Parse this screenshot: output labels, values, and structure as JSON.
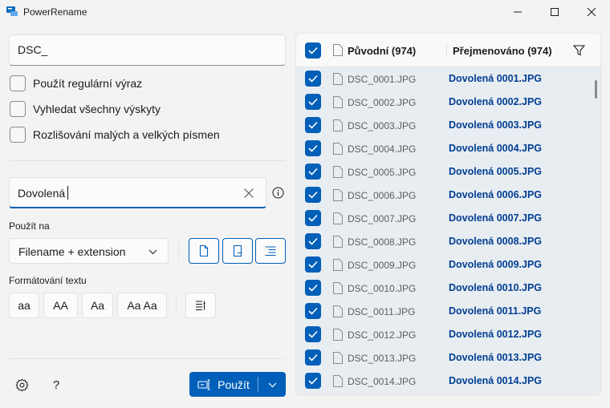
{
  "window": {
    "title": "PowerRename",
    "accent": "#005fb8"
  },
  "search": {
    "value": "DSC_",
    "options": [
      {
        "label": "Použít regulární výraz",
        "checked": false
      },
      {
        "label": "Vyhledat všechny výskyty",
        "checked": false
      },
      {
        "label": "Rozlišování malých a velkých písmen",
        "checked": false
      }
    ]
  },
  "replace": {
    "value": "Dovolená"
  },
  "apply_to": {
    "label": "Použít na",
    "selected": "Filename + extension"
  },
  "text_formatting": {
    "label": "Formátování textu",
    "buttons": [
      "aa",
      "AA",
      "Aa",
      "Aa Aa"
    ]
  },
  "footer": {
    "apply_label": "Použít",
    "help_label": "?"
  },
  "list": {
    "header_original": "Původní (974)",
    "header_renamed": "Přejmenováno (974)",
    "rows": [
      {
        "original": "DSC_0001.JPG",
        "renamed": "Dovolená 0001.JPG"
      },
      {
        "original": "DSC_0002.JPG",
        "renamed": "Dovolená 0002.JPG"
      },
      {
        "original": "DSC_0003.JPG",
        "renamed": "Dovolená 0003.JPG"
      },
      {
        "original": "DSC_0004.JPG",
        "renamed": "Dovolená 0004.JPG"
      },
      {
        "original": "DSC_0005.JPG",
        "renamed": "Dovolená 0005.JPG"
      },
      {
        "original": "DSC_0006.JPG",
        "renamed": "Dovolená 0006.JPG"
      },
      {
        "original": "DSC_0007.JPG",
        "renamed": "Dovolená 0007.JPG"
      },
      {
        "original": "DSC_0008.JPG",
        "renamed": "Dovolená 0008.JPG"
      },
      {
        "original": "DSC_0009.JPG",
        "renamed": "Dovolená 0009.JPG"
      },
      {
        "original": "DSC_0010.JPG",
        "renamed": "Dovolená 0010.JPG"
      },
      {
        "original": "DSC_0011.JPG",
        "renamed": "Dovolená 0011.JPG"
      },
      {
        "original": "DSC_0012.JPG",
        "renamed": "Dovolená 0012.JPG"
      },
      {
        "original": "DSC_0013.JPG",
        "renamed": "Dovolená 0013.JPG"
      },
      {
        "original": "DSC_0014.JPG",
        "renamed": "Dovolená 0014.JPG"
      }
    ]
  }
}
